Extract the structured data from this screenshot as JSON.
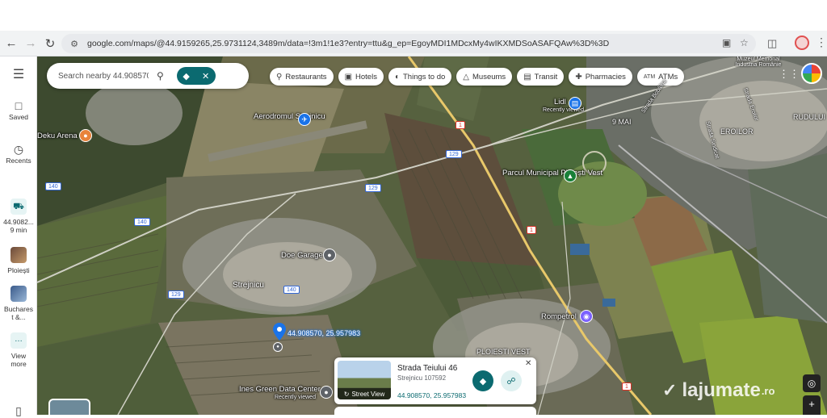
{
  "browser": {
    "url": "google.com/maps/@44.9159265,25.9731124,3489m/data=!3m1!1e3?entry=ttu&g_ep=EgoyMDI1MDcxMy4wIKXMDSoASAFQAw%3D%3D"
  },
  "rail": {
    "saved_label": "Saved",
    "recents_label": "Recents",
    "recent1_label": "44.9082...",
    "recent1_sub": "9 min",
    "recent2_label": "Ploiești",
    "recent3_label": "Buchares t &...",
    "more_label": "View more"
  },
  "search": {
    "placeholder": "Search nearby 44.908570, 25.95"
  },
  "chips": [
    {
      "label": "Restaurants",
      "icon": "fork-knife-icon"
    },
    {
      "label": "Hotels",
      "icon": "bed-icon"
    },
    {
      "label": "Things to do",
      "icon": "camera-icon"
    },
    {
      "label": "Museums",
      "icon": "museum-icon"
    },
    {
      "label": "Transit",
      "icon": "bus-icon"
    },
    {
      "label": "Pharmacies",
      "icon": "pharmacy-icon"
    },
    {
      "label": "ATMs",
      "icon": "atm-icon"
    }
  ],
  "map_labels": {
    "aerodrom": "Aerodromul Strejnicu",
    "deku": "Deku Arena",
    "lidl": "Lidl",
    "recently_viewed": "Recently viewed",
    "parc": "Parcul Municipal Ploiești Vest",
    "doe": "Doe Garage",
    "strejnicu": "Strejnicu",
    "rompetrol": "Rompetrol",
    "ploiesti_vest": "PLOIESTI VEST",
    "ines": "Ines Green Data Center",
    "ines_sub": "Recently viewed",
    "dropped_coords": "44.908570, 25.957983",
    "nouamai": "9 MAI",
    "eroilor": "EROILOR",
    "rudului": "RUDULUI",
    "strada_bobalna": "Strada Bobâlna",
    "strada_eroilor": "Strada Eroilor",
    "stada_sindicat": "Strada Sindicat",
    "muzeul": "Muzeul Memorial Industria Românie"
  },
  "road_shields": {
    "r140a": "140",
    "r140b": "140",
    "r140c": "140",
    "r129a": "129",
    "r129b": "129",
    "r129c": "129",
    "r1a": "1",
    "r1b": "1",
    "r1c": "1"
  },
  "card": {
    "street_view_label": "Street View",
    "address": "Strada Teiului 46",
    "zip": "Strejnicu 107592",
    "coords": "44.908570, 25.957983"
  },
  "watermark": {
    "brand": "lajumate",
    "tld": ".ro"
  }
}
